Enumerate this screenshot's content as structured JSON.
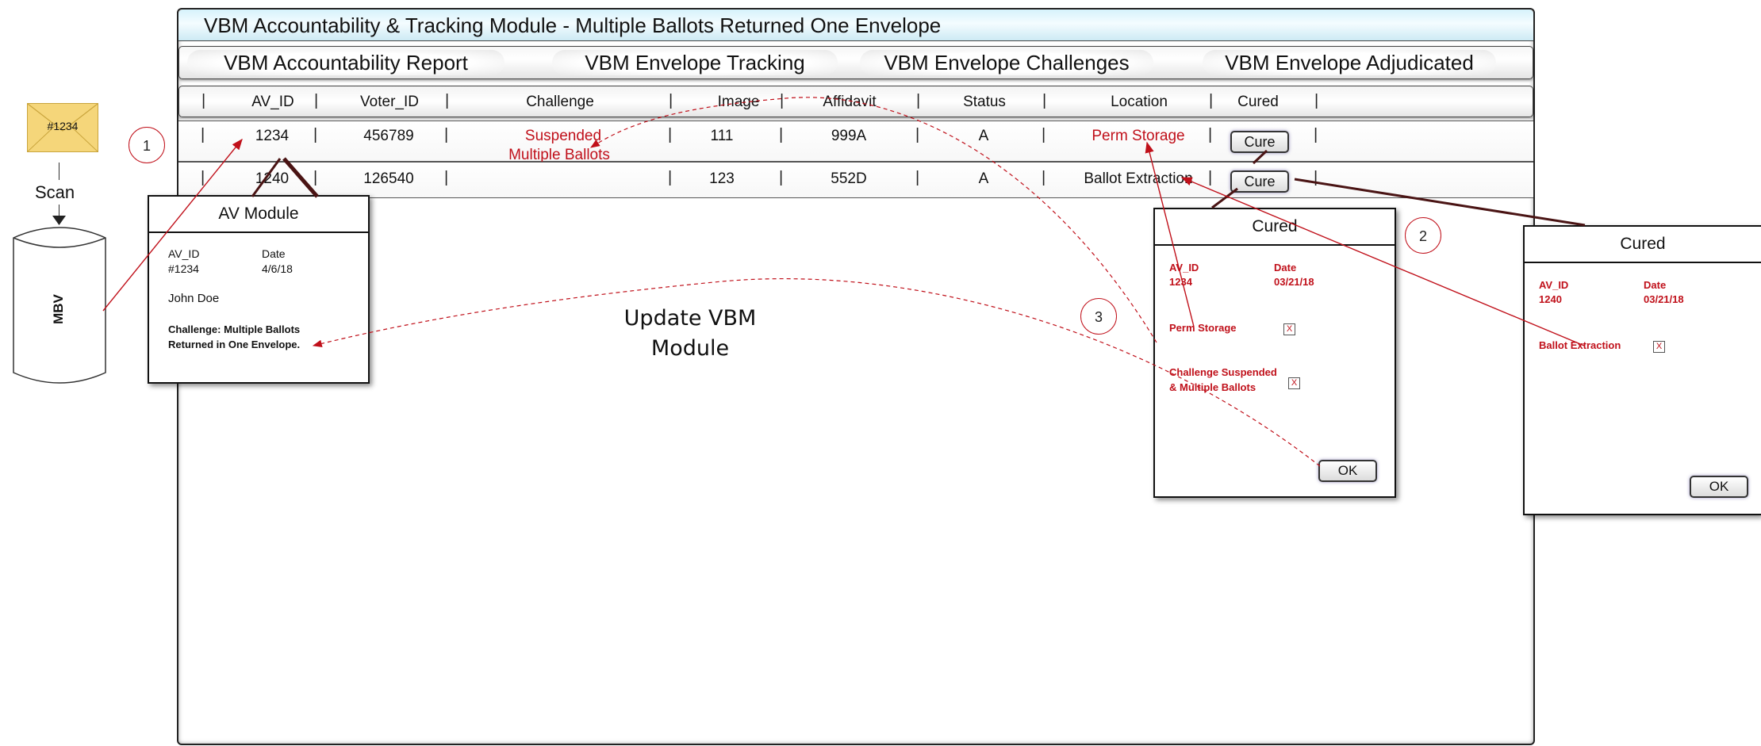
{
  "title": "VBM Accountability & Tracking Module -  Multiple Ballots Returned One Envelope",
  "tabs": [
    "VBM Accountability Report",
    "VBM Envelope Tracking",
    "VBM Envelope Challenges",
    "VBM Envelope Adjudicated"
  ],
  "columns": [
    "AV_ID",
    "Voter_ID",
    "Challenge",
    "Image",
    "Affidavit",
    "Status",
    "Location",
    "Cured"
  ],
  "rows": [
    {
      "av_id": "1234",
      "voter_id": "456789",
      "challenge_1": "Suspended",
      "challenge_2": "Multiple Ballots",
      "image": "111",
      "affidavit": "999A",
      "status": "A",
      "location": "Perm Storage",
      "cured": "Cure"
    },
    {
      "av_id": "1240",
      "voter_id": "126540",
      "challenge_1": "",
      "challenge_2": "",
      "image": "123",
      "affidavit": "552D",
      "status": "A",
      "location": "Ballot Extraction",
      "cured": "Cure"
    }
  ],
  "envelope": {
    "label": "#1234"
  },
  "scan_label": "Scan",
  "database_label": "MBV",
  "av_module": {
    "title": "AV Module",
    "av_id_label": "AV_ID",
    "av_id_value": "#1234",
    "date_label": "Date",
    "date_value": "4/6/18",
    "name": "John Doe",
    "challenge_line1": "Challenge: Multiple Ballots",
    "challenge_line2": "Returned in One Envelope."
  },
  "update_label_line1": "Update VBM",
  "update_label_line2": "Module",
  "cured_box_1": {
    "title": "Cured",
    "av_id_label": "AV_ID",
    "av_id_value": "1234",
    "date_label": "Date",
    "date_value": "03/21/18",
    "item1": "Perm Storage",
    "item2_line1": "Challenge Suspended",
    "item2_line2": "& Multiple Ballots",
    "check": "X",
    "ok": "OK"
  },
  "cured_box_2": {
    "title": "Cured",
    "av_id_label": "AV_ID",
    "av_id_value": "1240",
    "date_label": "Date",
    "date_value": "03/21/18",
    "item1": "Ballot Extraction",
    "check": "X",
    "ok": "OK"
  },
  "step_markers": [
    "1",
    "2",
    "3"
  ],
  "colors": {
    "annotation_red": "#c0101a",
    "title_bar": "#d6f2fb",
    "envelope": "#f5d67a",
    "connector": "#4a1414"
  }
}
